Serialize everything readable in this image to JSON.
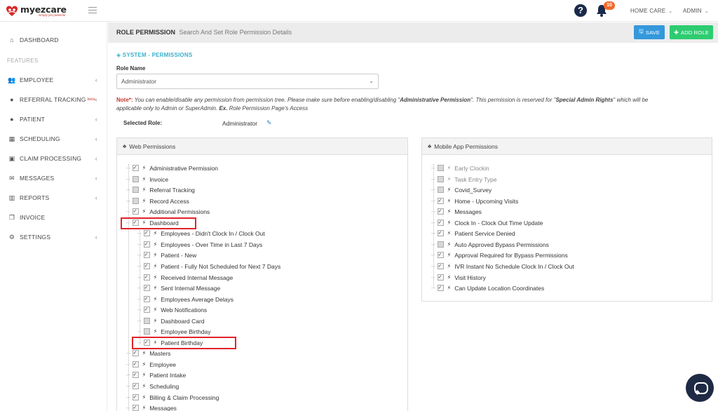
{
  "app": {
    "logo_text": "myezcare",
    "logo_tagline": "simply yet powerful",
    "notification_count": "10",
    "menu_home_care": "HOME CARE",
    "menu_admin": "ADMIN"
  },
  "sidebar": {
    "dashboard": "DASHBOARD",
    "section_features": "FEATURES",
    "items": [
      {
        "label": "EMPLOYEE",
        "icon": "users-icon",
        "chevron": true
      },
      {
        "label": "REFERRAL TRACKING",
        "icon": "user-icon",
        "chevron": true,
        "badge": "beta"
      },
      {
        "label": "PATIENT",
        "icon": "user-icon",
        "chevron": true
      },
      {
        "label": "SCHEDULING",
        "icon": "calendar-icon",
        "chevron": true
      },
      {
        "label": "CLAIM PROCESSING",
        "icon": "briefcase-icon",
        "chevron": true
      },
      {
        "label": "MESSAGES",
        "icon": "envelope-icon",
        "chevron": true
      },
      {
        "label": "REPORTS",
        "icon": "bar-chart-icon",
        "chevron": true
      },
      {
        "label": "INVOICE",
        "icon": "copy-icon",
        "chevron": false
      },
      {
        "label": "SETTINGS",
        "icon": "gear-icon",
        "chevron": true
      }
    ]
  },
  "header": {
    "title": "ROLE PERMISSION",
    "subtitle": "Search And Set Role Permission Details",
    "save_label": "SAVE",
    "add_role_label": "ADD ROLE"
  },
  "form": {
    "section_title": "SYSTEM - PERMISSIONS",
    "role_name_label": "Role Name",
    "role_name_value": "Administrator",
    "note_label": "Note*:",
    "note_part1": " You can enable/disable any permission from permission tree. Please make sure before enabling/disabling \"",
    "note_bold1": "Administrative Permission",
    "note_part2": "\". This permission is reserved for \"",
    "note_bold2": "Special Admin Rights",
    "note_part3": "\" which will be applicable only to Admin or SuperAdmin. ",
    "note_bold3": "Ex.",
    "note_part4": " Role Permission Page's Access",
    "selected_role_label": "Selected Role:",
    "selected_role_value": "Administrator"
  },
  "web_permissions": {
    "title": "Web Permissions",
    "items": [
      {
        "label": "Administrative Permission",
        "level": 0,
        "checked": true
      },
      {
        "label": "Invoice",
        "level": 0,
        "checked": false
      },
      {
        "label": "Referral Tracking",
        "level": 0,
        "checked": false
      },
      {
        "label": "Record Access",
        "level": 0,
        "checked": false
      },
      {
        "label": "Additional Permissions",
        "level": 0,
        "checked": true
      },
      {
        "label": "Dashboard",
        "level": 0,
        "checked": true
      },
      {
        "label": "Employees - Didn't Clock In / Clock Out",
        "level": 1,
        "checked": true
      },
      {
        "label": "Employees - Over Time in Last 7 Days",
        "level": 1,
        "checked": true
      },
      {
        "label": "Patient - New",
        "level": 1,
        "checked": true
      },
      {
        "label": "Patient - Fully Not Scheduled for Next 7 Days",
        "level": 1,
        "checked": true
      },
      {
        "label": "Received Internal Message",
        "level": 1,
        "checked": true
      },
      {
        "label": "Sent Internal Message",
        "level": 1,
        "checked": true
      },
      {
        "label": "Employees Average Delays",
        "level": 1,
        "checked": true
      },
      {
        "label": "Web Notifications",
        "level": 1,
        "checked": true
      },
      {
        "label": "Dashboard Card",
        "level": 1,
        "checked": false
      },
      {
        "label": "Employee Birthday",
        "level": 1,
        "checked": false
      },
      {
        "label": "Patient Birthday",
        "level": 1,
        "checked": true
      },
      {
        "label": "Masters",
        "level": 0,
        "checked": true
      },
      {
        "label": "Employee",
        "level": 0,
        "checked": true
      },
      {
        "label": "Patient Intake",
        "level": 0,
        "checked": true
      },
      {
        "label": "Scheduling",
        "level": 0,
        "checked": true
      },
      {
        "label": "Billing & Claim Processing",
        "level": 0,
        "checked": true
      },
      {
        "label": "Messages",
        "level": 0,
        "checked": true
      }
    ]
  },
  "mobile_permissions": {
    "title": "Mobile App Permissions",
    "items": [
      {
        "label": "Early Clockin",
        "checked": false,
        "muted": true
      },
      {
        "label": "Task Entry Type",
        "checked": false,
        "muted": true
      },
      {
        "label": "Covid_Survey",
        "checked": false,
        "muted": false
      },
      {
        "label": "Home - Upcoming Visits",
        "checked": true,
        "muted": false
      },
      {
        "label": "Messages",
        "checked": true,
        "muted": false
      },
      {
        "label": "Clock In - Clock Out Time Update",
        "checked": true,
        "muted": false
      },
      {
        "label": "Patient Service Denied",
        "checked": true,
        "muted": false
      },
      {
        "label": "Auto Approved Bypass Permissions",
        "checked": false,
        "muted": false
      },
      {
        "label": "Approval Required for Bypass Permissions",
        "checked": true,
        "muted": false
      },
      {
        "label": "IVR Instant No Schedule Clock In / Clock Out",
        "checked": true,
        "muted": false
      },
      {
        "label": "Visit History",
        "checked": true,
        "muted": false
      },
      {
        "label": "Can Update Location Coordinates",
        "checked": true,
        "muted": false
      }
    ]
  },
  "colors": {
    "accent_teal": "#3ab0c8",
    "save_blue": "#3498db",
    "add_green": "#2ecc71",
    "note_red": "#c0392b",
    "highlight_red": "#e2232a"
  }
}
